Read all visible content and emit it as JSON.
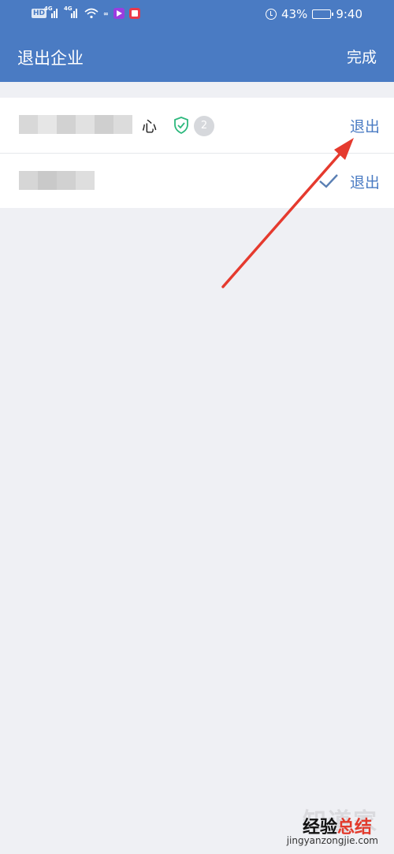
{
  "status_bar": {
    "network_badge": "HD",
    "network_type_1": "4G",
    "network_type_2": "4G",
    "speed": "∞",
    "battery_percent": "43%",
    "battery_level": 0.43,
    "time": "9:40"
  },
  "header": {
    "title": "退出企业",
    "done_label": "完成"
  },
  "companies": [
    {
      "name_visible_suffix": "心",
      "member_count": "2",
      "exit_label": "退出"
    },
    {
      "exit_label": "退出"
    }
  ],
  "watermark": {
    "ghost": "知道家",
    "brand_part1": "经验",
    "brand_part2": "总结",
    "url": "jingyanzongjie.com"
  },
  "colors": {
    "primary": "#4a7bc3",
    "background": "#eff0f4",
    "verified": "#2db87d",
    "annotation_arrow": "#e53a2e"
  }
}
